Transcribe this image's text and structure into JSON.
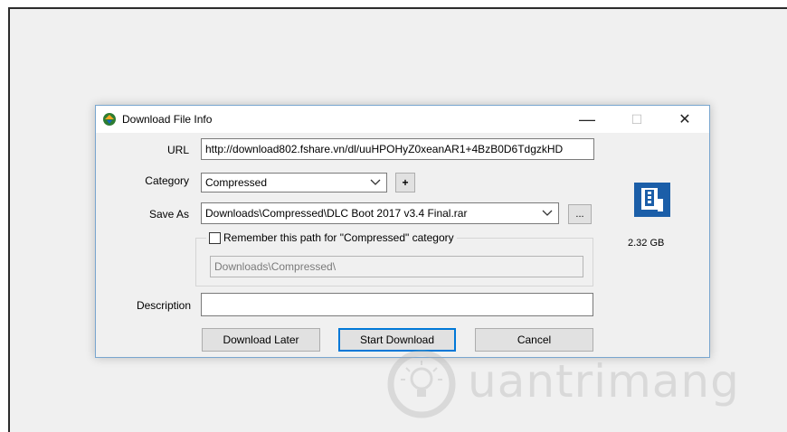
{
  "dialog": {
    "title": "Download File Info",
    "minimize_glyph": "—",
    "maximize_glyph": "☐",
    "close_glyph": "✕",
    "url_label": "URL",
    "url_value": "http://download802.fshare.vn/dl/uuHPOHyZ0xeanAR1+4BzB0D6TdgzkHD",
    "category_label": "Category",
    "category_value": "Compressed",
    "add_button": "+",
    "save_as_label": "Save As",
    "save_as_value": "Downloads\\Compressed\\DLC Boot 2017 v3.4 Final.rar",
    "browse_button": "...",
    "remember_label": "Remember this path for \"Compressed\" category",
    "remember_checked": false,
    "remember_path_value": "Downloads\\Compressed\\",
    "description_label": "Description",
    "description_value": "",
    "file_size": "2.32  GB",
    "buttons": {
      "later": "Download Later",
      "start": "Start Download",
      "cancel": "Cancel"
    }
  },
  "watermark": {
    "text": "uantrimang"
  },
  "icons": [
    "idm-app-icon",
    "minimize-icon",
    "maximize-icon",
    "close-icon",
    "dropdown-arrow-icon",
    "archive-file-icon",
    "lightbulb-icon"
  ],
  "colors": {
    "accent": "#0078d7",
    "dialog_border": "#79a6cf",
    "file_icon_bg": "#1b5ea8"
  }
}
